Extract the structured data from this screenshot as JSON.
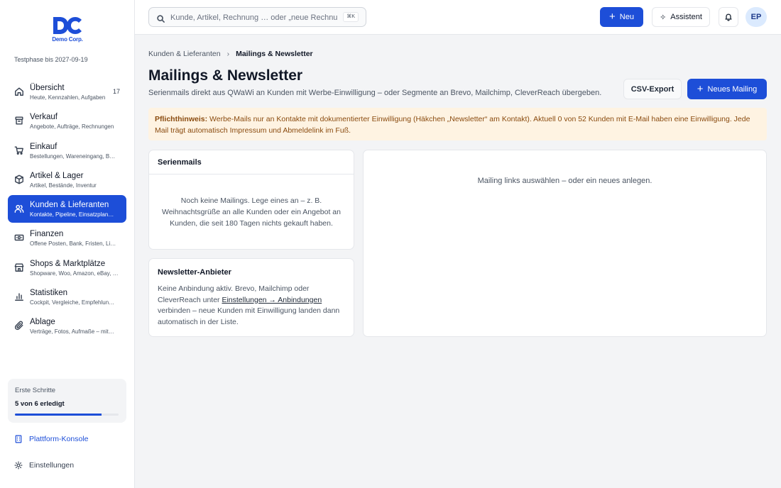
{
  "brand": {
    "name": "Demo Corp.",
    "trial": "Testphase bis 2027-09-19",
    "color": "#1d4ed8"
  },
  "sidebar": {
    "items": [
      {
        "label": "Übersicht",
        "sub": "Heute, Kennzahlen, Aufgaben",
        "badge": "17",
        "icon": "home-icon"
      },
      {
        "label": "Verkauf",
        "sub": "Angebote, Aufträge, Rechnungen",
        "icon": "archive-icon"
      },
      {
        "label": "Einkauf",
        "sub": "Bestellungen, Wareneingang, B…",
        "icon": "cart-icon"
      },
      {
        "label": "Artikel & Lager",
        "sub": "Artikel, Bestände, Inventur",
        "icon": "box-icon"
      },
      {
        "label": "Kunden & Lieferanten",
        "sub": "Kontakte, Pipeline, Einsatzplan…",
        "icon": "users-icon",
        "active": true
      },
      {
        "label": "Finanzen",
        "sub": "Offene Posten, Bank, Fristen, Li…",
        "icon": "banknote-icon"
      },
      {
        "label": "Shops & Marktplätze",
        "sub": "Shopware, Woo, Amazon, eBay, …",
        "icon": "shop-icon"
      },
      {
        "label": "Statistiken",
        "sub": "Cockpit, Vergleiche, Empfehlun…",
        "icon": "bar-chart-icon"
      },
      {
        "label": "Ablage",
        "sub": "Verträge, Fotos, Aufmaße – mit…",
        "icon": "paperclip-icon"
      }
    ],
    "steps": {
      "title": "Erste Schritte",
      "progress": "5 von 6 erledigt",
      "fraction": 0.833
    },
    "platform": "Plattform-Konsole",
    "settings": "Einstellungen"
  },
  "topbar": {
    "search_placeholder": "Kunde, Artikel, Rechnung … oder „neue Rechnung“",
    "shortcut": "⌘K",
    "new_label": "Neu",
    "assistant_label": "Assistent",
    "avatar": "EP"
  },
  "page": {
    "breadcrumb_parent": "Kunden & Lieferanten",
    "breadcrumb_current": "Mailings & Newsletter",
    "title": "Mailings & Newsletter",
    "subtitle": "Serienmails direkt aus QWaWi an Kunden mit Werbe-Einwilligung – oder Segmente an Brevo, Mailchimp, CleverReach übergeben.",
    "csv_label": "CSV-Export",
    "new_mailing_label": "Neues Mailing",
    "notice_label": "Pflichthinweis:",
    "notice_text": " Werbe-Mails nur an Kontakte mit dokumentierter Einwilligung (Häkchen „Newsletter“ am Kontakt). Aktuell 0 von 52 Kunden mit E-Mail haben eine Einwilligung. Jede Mail trägt automatisch Impressum und Abmeldelink im Fuß.",
    "serien_title": "Serienmails",
    "serien_empty": "Noch keine Mailings. Lege eines an – z. B. Weihnachtsgrüße an alle Kunden oder ein Angebot an Kunden, die seit 180 Tagen nichts gekauft haben.",
    "news_title": "Newsletter-Anbieter",
    "news_text_a": "Keine Anbindung aktiv. Brevo, Mailchimp oder CleverReach unter ",
    "news_link": "Einstellungen → Anbindungen",
    "news_text_b": " verbinden – neue Kunden mit Einwilligung landen dann automatisch in der Liste.",
    "right_empty": "Mailing links auswählen – oder ein neues anlegen."
  }
}
